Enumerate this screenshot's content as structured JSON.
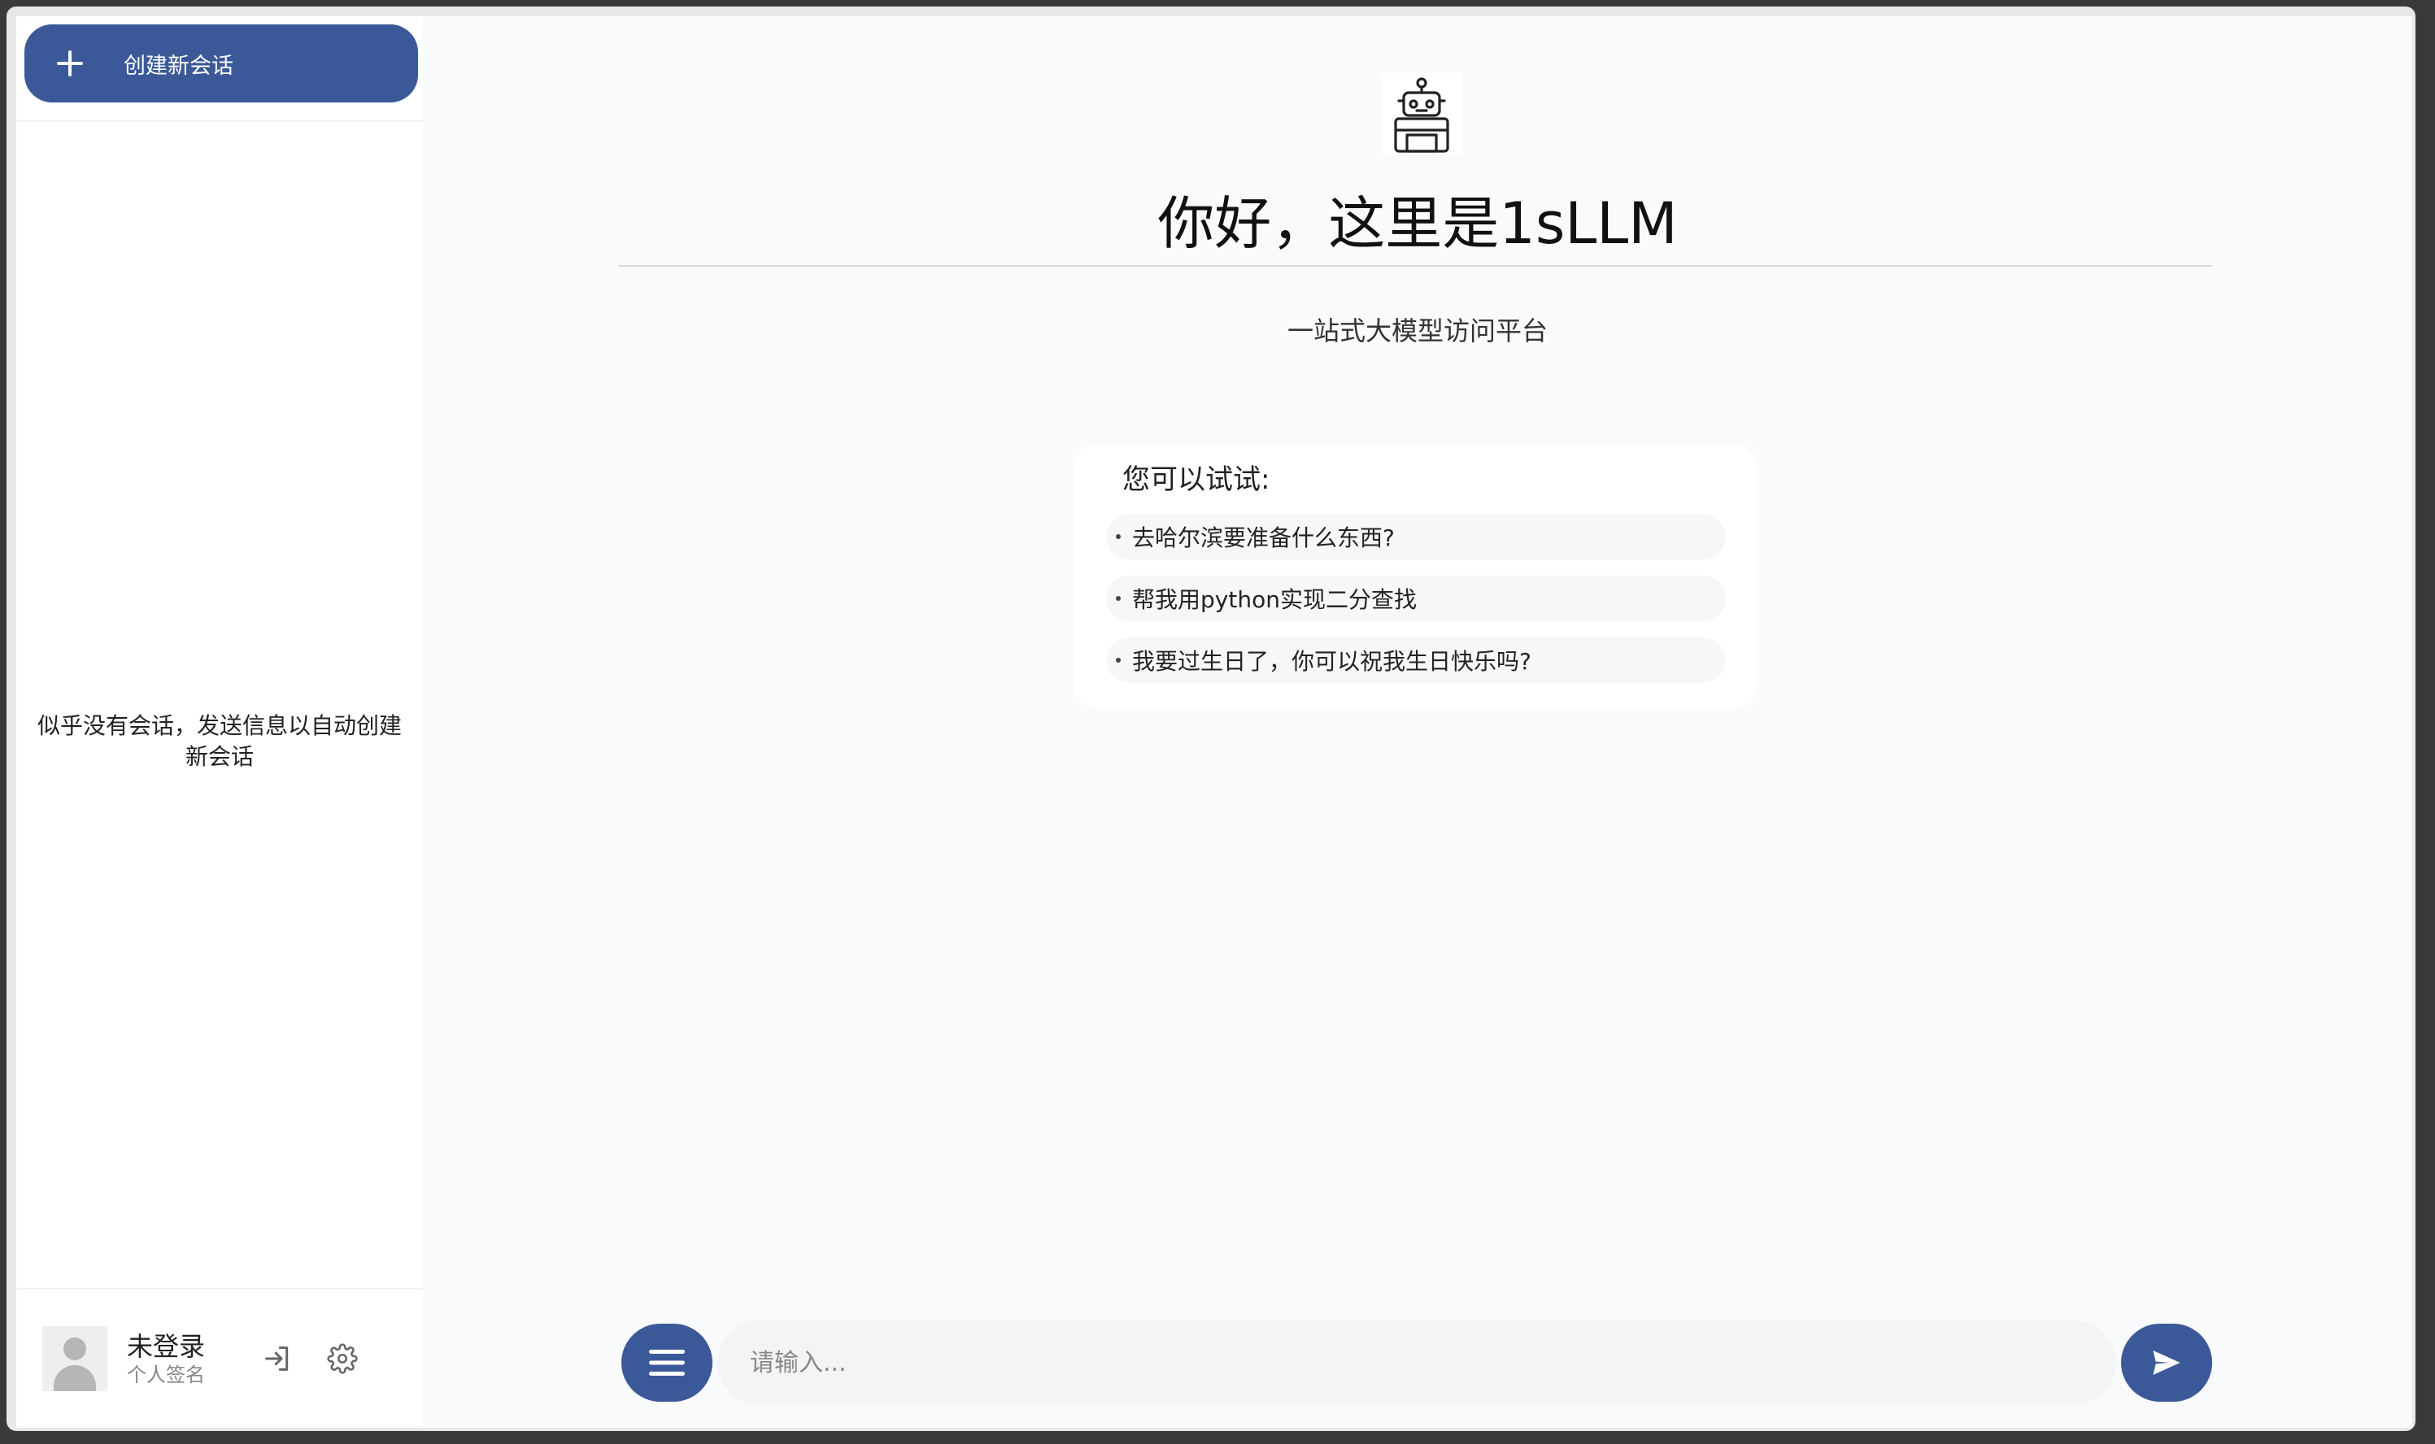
{
  "sidebar": {
    "new_chat_label": "创建新会话",
    "empty_hint": "似乎没有会话，发送信息以自动创建新会话",
    "user": {
      "name": "未登录",
      "signature": "个人签名"
    }
  },
  "main": {
    "title": "你好，这里是1sLLM",
    "subtitle": "一站式大模型访问平台",
    "suggestions": {
      "title": "您可以试试:",
      "items": [
        "去哈尔滨要准备什么东西?",
        "帮我用python实现二分查找",
        "我要过生日了，你可以祝我生日快乐吗?"
      ]
    },
    "input": {
      "placeholder": "请输入..."
    }
  },
  "colors": {
    "accent": "#3b5998",
    "background": "#f9fafb",
    "sidebar": "#ffffff"
  },
  "icons": {
    "new_chat": "plus-icon",
    "logo": "robot-icon",
    "login": "login-icon",
    "settings": "gear-icon",
    "menu": "menu-icon",
    "send": "send-icon",
    "avatar": "user-avatar-icon"
  }
}
